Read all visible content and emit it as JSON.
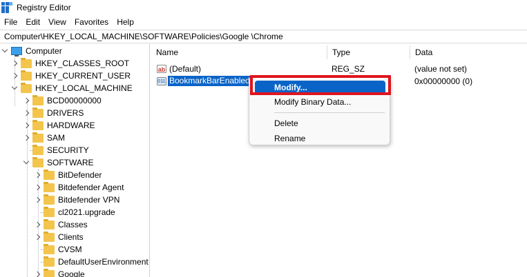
{
  "window": {
    "title": "Registry Editor"
  },
  "menu": [
    "File",
    "Edit",
    "View",
    "Favorites",
    "Help"
  ],
  "address": "Computer\\HKEY_LOCAL_MACHINE\\SOFTWARE\\Policies\\Google \\Chrome",
  "tree": {
    "root": "Computer",
    "hives": [
      "HKEY_CLASSES_ROOT",
      "HKEY_CURRENT_USER",
      "HKEY_LOCAL_MACHINE"
    ],
    "hklm_children": [
      "BCD00000000",
      "DRIVERS",
      "HARDWARE",
      "SAM",
      "SECURITY",
      "SOFTWARE"
    ],
    "software_children": [
      "BitDefender",
      "Bitdefender Agent",
      "Bitdefender VPN",
      "cl2021.upgrade",
      "Classes",
      "Clients",
      "CVSM",
      "DefaultUserEnvironment",
      "Google"
    ]
  },
  "list": {
    "columns": [
      "Name",
      "Type",
      "Data"
    ],
    "rows": [
      {
        "name": "(Default)",
        "type": "REG_SZ",
        "data": "(value not set)",
        "icon": "string-value-icon"
      },
      {
        "name": "BookmarkBarEnabled",
        "type": "",
        "data": "0x00000000 (0)",
        "icon": "dword-value-icon"
      }
    ]
  },
  "context_menu": {
    "items": [
      "Modify...",
      "Modify Binary Data...",
      "Delete",
      "Rename"
    ],
    "highlighted": "Modify..."
  },
  "colors": {
    "selection": "#0a64c8",
    "annotation": "#e0141e",
    "folder": "#f3c54d"
  }
}
